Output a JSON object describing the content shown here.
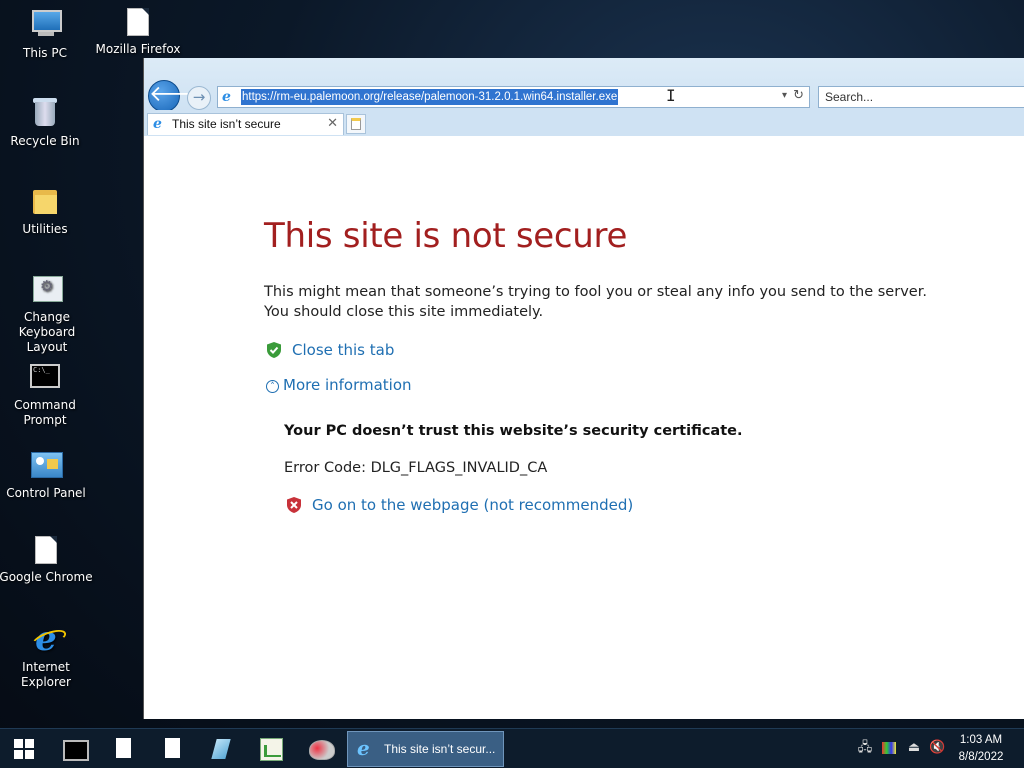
{
  "desktop": {
    "icons": [
      {
        "label": "This PC",
        "icon": "this-pc-icon"
      },
      {
        "label": "Mozilla Firefox",
        "icon": "document-icon"
      },
      {
        "label": "Recycle Bin",
        "icon": "recycle-bin-icon"
      },
      {
        "label": "Utilities",
        "icon": "folder-icon"
      },
      {
        "label": "Change Keyboard Layout",
        "icon": "keyboard-settings-icon"
      },
      {
        "label": "Command Prompt",
        "icon": "command-prompt-icon"
      },
      {
        "label": "Control Panel",
        "icon": "control-panel-icon"
      },
      {
        "label": "Google Chrome",
        "icon": "document-icon"
      },
      {
        "label": "Internet Explorer",
        "icon": "internet-explorer-icon"
      }
    ]
  },
  "browser": {
    "address_url": "https://rm-eu.palemoon.org/release/palemoon-31.2.0.1.win64.installer.exe",
    "search_placeholder": "Search...",
    "tab_title": "This site isn’t secure",
    "close_glyph": "✕",
    "back_glyph": "🡐",
    "forward_glyph": "→",
    "dropdown_glyph": "▾",
    "refresh_glyph": "↻"
  },
  "page": {
    "title": "This site is not secure",
    "description": "This might mean that someone’s trying to fool you or steal any info you send to the server. You should close this site immediately.",
    "close_tab_label": "Close this tab",
    "more_info_label": "More information",
    "more_info_glyph": "˄",
    "details_heading": "Your PC doesn’t trust this website’s security certificate.",
    "error_code": "Error Code: DLG_FLAGS_INVALID_CA",
    "go_on_label": "Go on to the webpage (not recommended)",
    "colors": {
      "title": "#a21f1f",
      "link": "#1f6fb2",
      "safe_shield": "#3a9b3a",
      "danger_shield": "#c8323a"
    }
  },
  "taskbar": {
    "active_window_label": "This site isn’t secur...",
    "clock_time": "1:03 AM",
    "clock_date": "8/8/2022"
  }
}
